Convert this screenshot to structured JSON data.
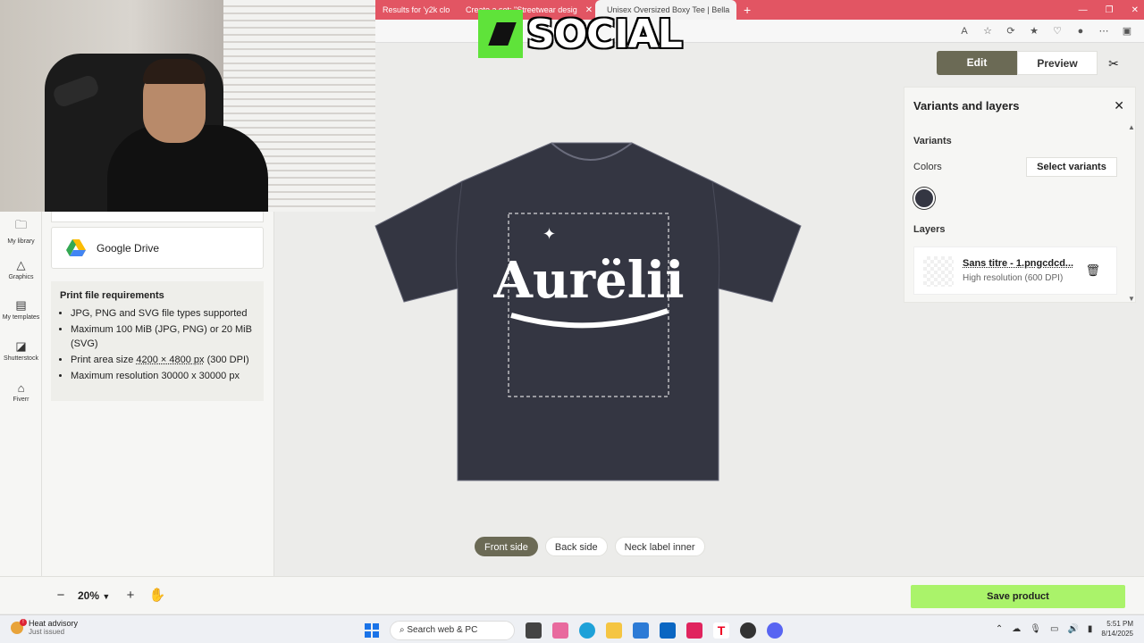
{
  "browser": {
    "tabs": [
      {
        "label": "Results for 'y2k clo",
        "active": false
      },
      {
        "label": "Create a set: \"Streetwear desig",
        "active": false
      },
      {
        "label": "Unisex Oversized Boxy Tee | Bella",
        "active": true
      }
    ]
  },
  "overlay": {
    "logo_word": "SOCIAL"
  },
  "rail": {
    "items": [
      {
        "label": "My library",
        "icon": "folder-icon"
      },
      {
        "label": "Graphics",
        "icon": "shapes-icon"
      },
      {
        "label": "My templates",
        "icon": "templates-icon"
      },
      {
        "label": "Shutterstock",
        "icon": "shutterstock-icon"
      },
      {
        "label": "Fiverr",
        "icon": "fiverr-icon"
      }
    ]
  },
  "left_panel": {
    "gdrive_label": "Google Drive",
    "requirements": {
      "title": "Print file requirements",
      "items": [
        "JPG, PNG and SVG file types supported",
        "Maximum 100 MiB (JPG, PNG) or 20 MiB (SVG)",
        "Print area size 4200 × 4800 px (300 DPI)",
        "Maximum resolution 30000 x 30000 px"
      ],
      "size_prefix": "Print area size ",
      "size_value": "4200 × 4800 px",
      "size_suffix": " (300 DPI)"
    }
  },
  "toolbar": {
    "zoom": "20%",
    "save_label": "Save product"
  },
  "editor": {
    "edit_label": "Edit",
    "preview_label": "Preview"
  },
  "canvas": {
    "tshirt_color": "#343642",
    "design_text": "Aurëlii",
    "sides": [
      {
        "label": "Front side",
        "active": true
      },
      {
        "label": "Back side",
        "active": false
      },
      {
        "label": "Neck label inner",
        "active": false
      }
    ]
  },
  "right_panel": {
    "title": "Variants and layers",
    "variants_heading": "Variants",
    "colors_label": "Colors",
    "select_variants_label": "Select variants",
    "selected_color": "#343642",
    "layers_heading": "Layers",
    "layer": {
      "name": "Sans titre - 1.pngcdcd...",
      "resolution": "High resolution (600 DPI)"
    }
  },
  "taskbar": {
    "weather_title": "Heat advisory",
    "weather_sub": "Just issued",
    "search_placeholder": "Search web & PC",
    "time": "5:51 PM",
    "date": "8/14/2025"
  }
}
